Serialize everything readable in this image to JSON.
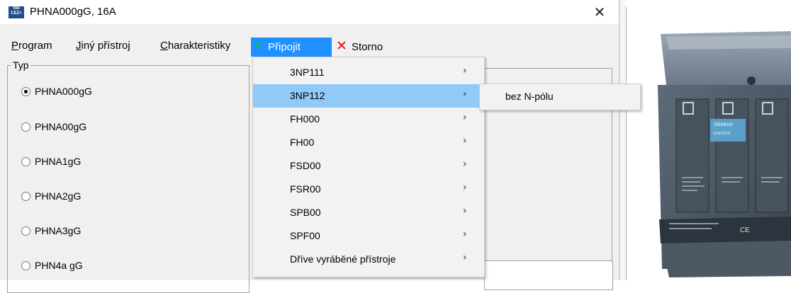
{
  "window": {
    "title": "PHNA000gG, 16A",
    "logo_text": "Ste CEZ+",
    "close_glyph": "✕"
  },
  "menubar": {
    "program": "Program",
    "jiny_pristroj": "Jiný přístroj",
    "charakteristiky": "Charakteristiky",
    "pripojit": "Připojit",
    "storno": "Storno"
  },
  "typ_group": {
    "label": "Typ",
    "options": [
      {
        "label": "PHNA000gG",
        "selected": true
      },
      {
        "label": "PHNA00gG",
        "selected": false
      },
      {
        "label": "PHNA1gG",
        "selected": false
      },
      {
        "label": "PHNA2gG",
        "selected": false
      },
      {
        "label": "PHNA3gG",
        "selected": false
      },
      {
        "label": "PHN4a gG",
        "selected": false
      }
    ]
  },
  "dropdown": {
    "items": [
      {
        "label": "3NP111"
      },
      {
        "label": "3NP112"
      },
      {
        "label": "FH000"
      },
      {
        "label": "FH00"
      },
      {
        "label": "FSD00"
      },
      {
        "label": "FSR00"
      },
      {
        "label": "SPB00"
      },
      {
        "label": "SPF00"
      },
      {
        "label": "Dříve vyráběné přístroje"
      }
    ],
    "highlighted": "3NP112",
    "arrow": "›"
  },
  "submenu": {
    "items": [
      {
        "label": "bez N-pólu"
      }
    ]
  },
  "photo": {
    "brand": "SIEMENS",
    "product": "SENTRON",
    "marks": "CE"
  },
  "colors": {
    "menu_highlight": "#1e90ff",
    "item_highlight": "#91c9f7",
    "check_green": "#19c219",
    "cancel_red": "#e01010"
  }
}
